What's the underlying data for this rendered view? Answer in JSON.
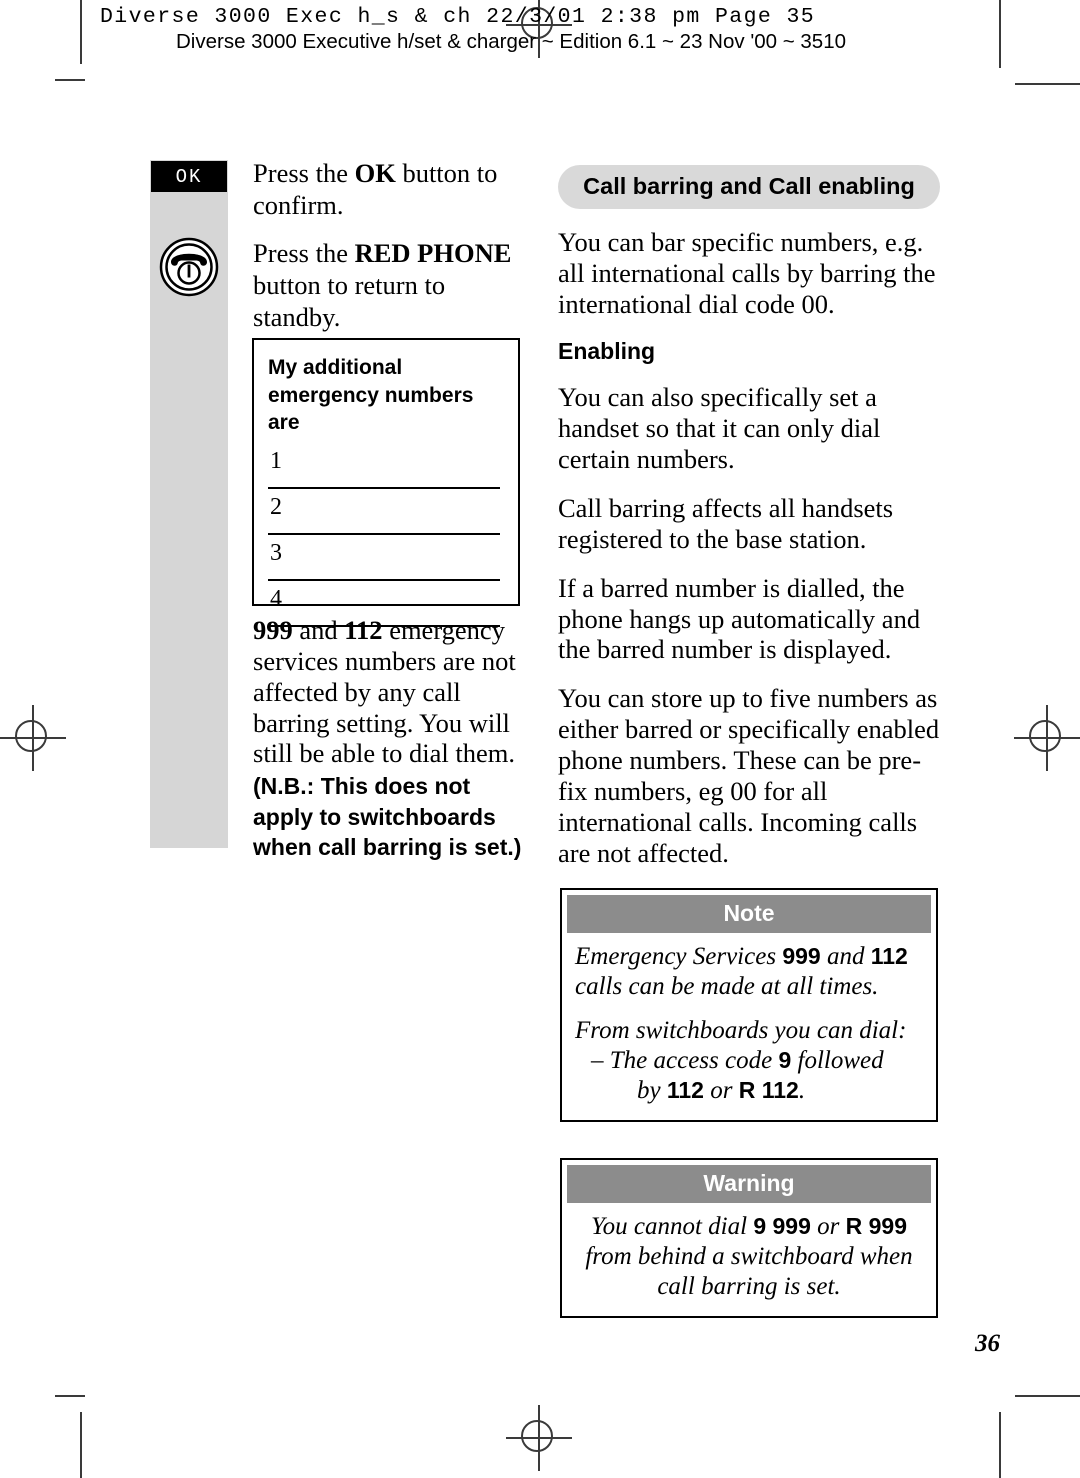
{
  "header": {
    "filename_line": "Diverse 3000 Exec h_s & ch  22/3/01  2:38 pm  Page 35",
    "edition_line": "Diverse 3000 Executive h/set & charger ~ Edition 6.1 ~ 23 Nov '00 ~ 3510"
  },
  "left_column": {
    "ok_key_label": "OK",
    "phone_icon_name": "red-phone-key-icon",
    "instruction_1_pre": "Press the ",
    "instruction_1_bold": "OK",
    "instruction_1_post": " button to confirm.",
    "instruction_2_pre": "Press the ",
    "instruction_2_bold": "RED PHONE",
    "instruction_2_post": " button to return to standby.",
    "emergency_box": {
      "title_line_1": "My additional",
      "title_line_2": "emergency numbers are",
      "entries": [
        "1",
        "2",
        "3",
        "4"
      ]
    },
    "note_999_b1": "999",
    "note_999_mid": " and ",
    "note_999_b2": "112",
    "note_999_rest": " emergency services numbers are not affected by any call barring setting. You will still be able to dial them.",
    "nb_text": "(N.B.: This does not apply to switchboards when call barring is set.)"
  },
  "right_column": {
    "section_title": "Call barring and Call enabling",
    "para_1": "You can bar specific numbers, e.g. all international calls by barring the international dial code 00.",
    "subheading_enabling": "Enabling",
    "para_2": "You can also specifically set a handset so that it can only dial certain numbers.",
    "para_3": "Call barring affects all handsets registered to the base station.",
    "para_4": "If a barred number is dialled, the phone hangs up automatically and the barred number is displayed.",
    "para_5": "You can store up to five numbers as either barred or specifically enabled phone numbers. These can be pre-fix numbers, eg 00 for all international calls. Incoming calls are not affected."
  },
  "note_box": {
    "heading": "Note",
    "line_1_pre": "Emergency Services ",
    "line_1_b1": "999",
    "line_1_mid": " and ",
    "line_1_b2": "112",
    "line_1_post": " calls can be made at all times.",
    "line_2": "From switchboards you can dial:",
    "line_3_pre": "– The access code ",
    "line_3_b1": "9",
    "line_3_post": " followed",
    "line_4_pre": "by ",
    "line_4_b1": "112",
    "line_4_mid": " or ",
    "line_4_b2": "R 112",
    "line_4_post": "."
  },
  "warning_box": {
    "heading": "Warning",
    "line_1_pre": "You cannot dial ",
    "line_1_b1": "9 999",
    "line_1_mid": " or ",
    "line_1_b2": "R 999",
    "line_2": "from behind a switchboard when",
    "line_3": "call barring is set."
  },
  "footer": {
    "page_number": "36"
  },
  "colors": {
    "rail_grey": "#d6d6d6",
    "pill_grey": "#d9d9d9",
    "callout_head_grey": "#8c8c8c",
    "key_black": "#000000",
    "crop_mark": "#3a3a3a"
  }
}
